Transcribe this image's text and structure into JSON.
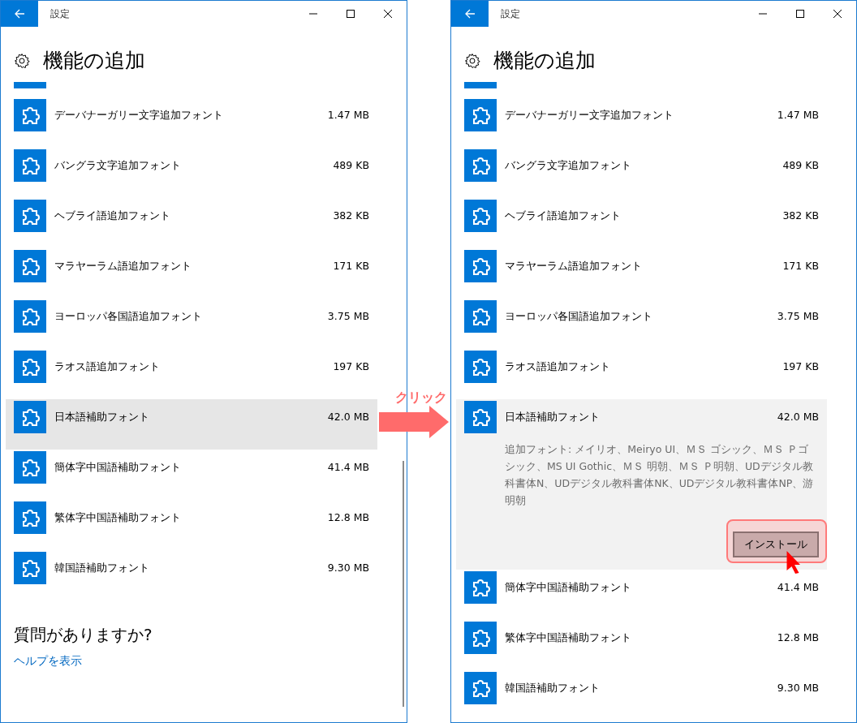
{
  "windows": [
    {
      "title": "設定",
      "heading": "機能の追加",
      "scrollbar": true,
      "features": [
        {
          "name": "デーバナーガリー文字追加フォント",
          "size": "1.47 MB",
          "selected": false,
          "expanded": false
        },
        {
          "name": "バングラ文字追加フォント",
          "size": "489 KB",
          "selected": false,
          "expanded": false
        },
        {
          "name": "ヘブライ語追加フォント",
          "size": "382 KB",
          "selected": false,
          "expanded": false
        },
        {
          "name": "マラヤーラム語追加フォント",
          "size": "171 KB",
          "selected": false,
          "expanded": false
        },
        {
          "name": "ヨーロッパ各国語追加フォント",
          "size": "3.75 MB",
          "selected": false,
          "expanded": false
        },
        {
          "name": "ラオス語追加フォント",
          "size": "197 KB",
          "selected": false,
          "expanded": false
        },
        {
          "name": "日本語補助フォント",
          "size": "42.0 MB",
          "selected": true,
          "expanded": false
        },
        {
          "name": "簡体字中国語補助フォント",
          "size": "41.4 MB",
          "selected": false,
          "expanded": false
        },
        {
          "name": "繁体字中国語補助フォント",
          "size": "12.8 MB",
          "selected": false,
          "expanded": false
        },
        {
          "name": "韓国語補助フォント",
          "size": "9.30 MB",
          "selected": false,
          "expanded": false
        }
      ],
      "help": {
        "question": "質問がありますか?",
        "link": "ヘルプを表示"
      }
    },
    {
      "title": "設定",
      "heading": "機能の追加",
      "scrollbar": false,
      "features": [
        {
          "name": "デーバナーガリー文字追加フォント",
          "size": "1.47 MB",
          "selected": false,
          "expanded": false
        },
        {
          "name": "バングラ文字追加フォント",
          "size": "489 KB",
          "selected": false,
          "expanded": false
        },
        {
          "name": "ヘブライ語追加フォント",
          "size": "382 KB",
          "selected": false,
          "expanded": false
        },
        {
          "name": "マラヤーラム語追加フォント",
          "size": "171 KB",
          "selected": false,
          "expanded": false
        },
        {
          "name": "ヨーロッパ各国語追加フォント",
          "size": "3.75 MB",
          "selected": false,
          "expanded": false
        },
        {
          "name": "ラオス語追加フォント",
          "size": "197 KB",
          "selected": false,
          "expanded": false
        },
        {
          "name": "日本語補助フォント",
          "size": "42.0 MB",
          "selected": true,
          "expanded": true,
          "description": "追加フォント: メイリオ、Meiryo UI、ＭＳ ゴシック、ＭＳ Ｐゴシック、MS UI Gothic、ＭＳ 明朝、ＭＳ Ｐ明朝、UDデジタル教科書体N、UDデジタル教科書体NK、UDデジタル教科書体NP、游明朝",
          "button": {
            "label": "インストール",
            "highlighted": true
          }
        },
        {
          "name": "簡体字中国語補助フォント",
          "size": "41.4 MB",
          "selected": false,
          "expanded": false
        },
        {
          "name": "繁体字中国語補助フォント",
          "size": "12.8 MB",
          "selected": false,
          "expanded": false
        },
        {
          "name": "韓国語補助フォント",
          "size": "9.30 MB",
          "selected": false,
          "expanded": false
        }
      ]
    }
  ],
  "annotation": {
    "label": "クリック"
  }
}
